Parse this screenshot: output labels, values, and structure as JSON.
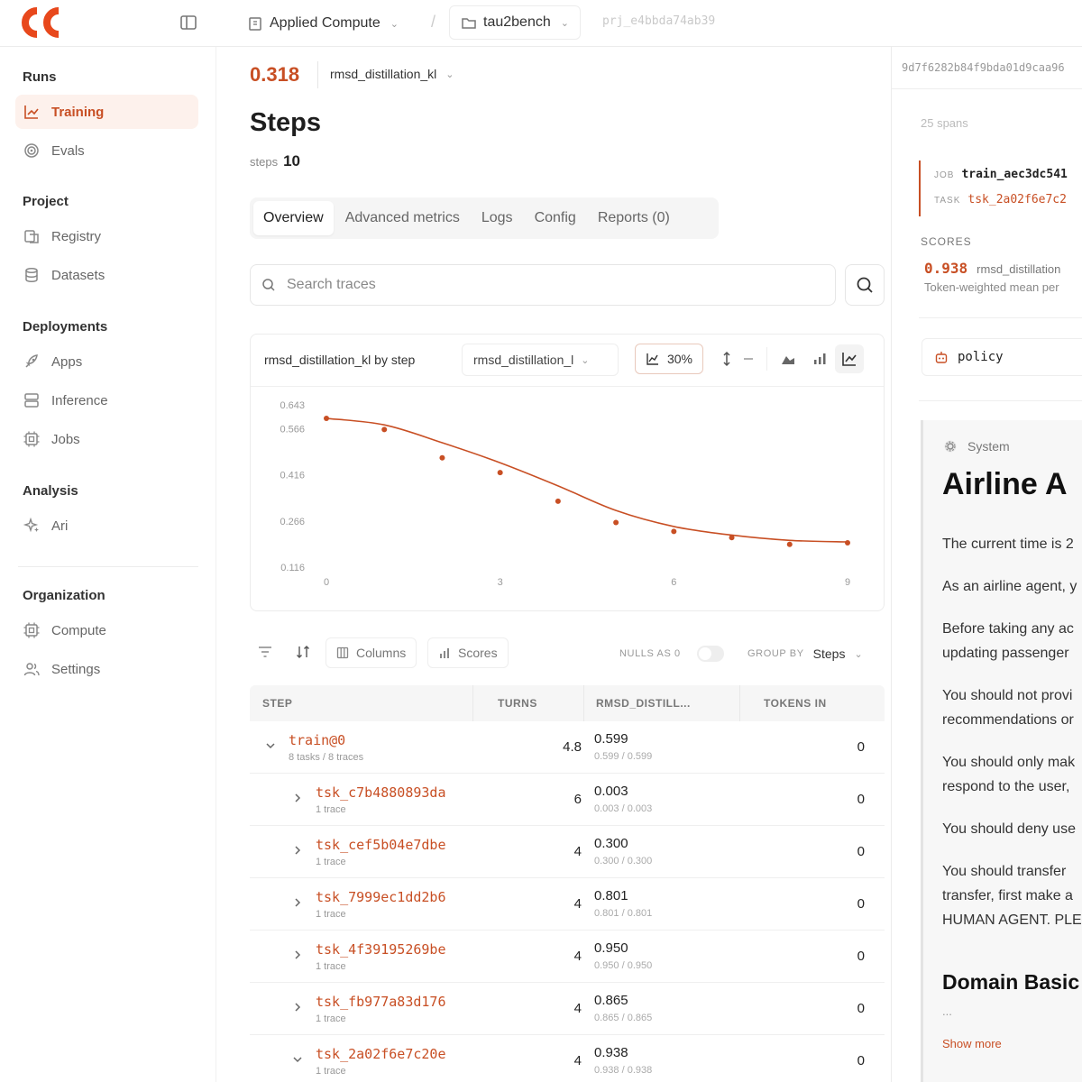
{
  "topbar": {
    "org": "Applied Compute",
    "project": "tau2bench",
    "project_id": "prj_e4bbda74ab39"
  },
  "sidebar": {
    "sections": [
      {
        "title": "Runs",
        "items": [
          {
            "label": "Training",
            "icon": "chart-line-icon",
            "active": true
          },
          {
            "label": "Evals",
            "icon": "target-icon"
          }
        ]
      },
      {
        "title": "Project",
        "items": [
          {
            "label": "Registry",
            "icon": "registry-icon"
          },
          {
            "label": "Datasets",
            "icon": "database-icon"
          }
        ]
      },
      {
        "title": "Deployments",
        "items": [
          {
            "label": "Apps",
            "icon": "rocket-icon"
          },
          {
            "label": "Inference",
            "icon": "server-icon"
          },
          {
            "label": "Jobs",
            "icon": "cpu-icon"
          }
        ]
      },
      {
        "title": "Analysis",
        "items": [
          {
            "label": "Ari",
            "icon": "sparkle-icon"
          }
        ]
      },
      {
        "title": "Organization",
        "items": [
          {
            "label": "Compute",
            "icon": "chip-icon"
          },
          {
            "label": "Settings",
            "icon": "users-icon"
          }
        ]
      }
    ]
  },
  "main": {
    "metric_value": "0.318",
    "metric_name": "rmsd_distillation_kl",
    "title": "Steps",
    "steps_label": "steps",
    "steps_value": "10",
    "tabs": [
      "Overview",
      "Advanced metrics",
      "Logs",
      "Config",
      "Reports (0)"
    ],
    "active_tab": 0,
    "search_placeholder": "Search traces"
  },
  "chart": {
    "title": "rmsd_distillation_kl by step",
    "select_value": "rmsd_distillation_l",
    "smoothing_label": "30%"
  },
  "chart_data": {
    "type": "line",
    "title": "rmsd_distillation_kl by step",
    "x": [
      0,
      1,
      2,
      3,
      4,
      5,
      6,
      7,
      8,
      9
    ],
    "y_points": [
      0.599,
      0.563,
      0.471,
      0.423,
      0.33,
      0.261,
      0.232,
      0.212,
      0.19,
      0.195
    ],
    "y_smoothed": [
      0.599,
      0.578,
      0.52,
      0.455,
      0.38,
      0.3,
      0.248,
      0.22,
      0.203,
      0.198
    ],
    "x_ticks": [
      0,
      3,
      6,
      9
    ],
    "y_ticks": [
      "0.643",
      "0.566",
      "0.416",
      "0.266",
      "0.116"
    ],
    "ylim": [
      0.116,
      0.643
    ],
    "xlim": [
      0,
      9
    ],
    "color": "#c84f24",
    "grid": false
  },
  "toolbar": {
    "columns_label": "Columns",
    "scores_label": "Scores",
    "nulls_label": "NULLS AS 0",
    "group_by_label": "GROUP BY",
    "group_by_value": "Steps"
  },
  "table": {
    "headers": [
      "STEP",
      "TURNS",
      "RMSD_DISTILL...",
      "TOKENS IN"
    ],
    "rows": [
      {
        "name": "train@0",
        "sub": "8 tasks / 8 traces",
        "turns": "4.8",
        "value": "0.599",
        "value_sub": "0.599 / 0.599",
        "tokens": "0",
        "level": 0,
        "expanded": true
      },
      {
        "name": "tsk_c7b4880893da",
        "sub": "1 trace",
        "turns": "6",
        "value": "0.003",
        "value_sub": "0.003 / 0.003",
        "tokens": "0",
        "level": 1,
        "expanded": false
      },
      {
        "name": "tsk_cef5b04e7dbe",
        "sub": "1 trace",
        "turns": "4",
        "value": "0.300",
        "value_sub": "0.300 / 0.300",
        "tokens": "0",
        "level": 1,
        "expanded": false
      },
      {
        "name": "tsk_7999ec1dd2b6",
        "sub": "1 trace",
        "turns": "4",
        "value": "0.801",
        "value_sub": "0.801 / 0.801",
        "tokens": "0",
        "level": 1,
        "expanded": false
      },
      {
        "name": "tsk_4f39195269be",
        "sub": "1 trace",
        "turns": "4",
        "value": "0.950",
        "value_sub": "0.950 / 0.950",
        "tokens": "0",
        "level": 1,
        "expanded": false
      },
      {
        "name": "tsk_fb977a83d176",
        "sub": "1 trace",
        "turns": "4",
        "value": "0.865",
        "value_sub": "0.865 / 0.865",
        "tokens": "0",
        "level": 1,
        "expanded": false
      },
      {
        "name": "tsk_2a02f6e7c20e",
        "sub": "1 trace",
        "turns": "4",
        "value": "0.938",
        "value_sub": "0.938 / 0.938",
        "tokens": "0",
        "level": 1,
        "expanded": true
      }
    ]
  },
  "right_panel": {
    "trace_id": "9d7f6282b84f9bda01d9caa96",
    "spans": "25 spans",
    "job_label": "JOB",
    "job_value": "train_aec3dc541",
    "task_label": "TASK",
    "task_value": "tsk_2a02f6e7c2",
    "scores_heading": "SCORES",
    "score_value": "0.938",
    "score_name": "rmsd_distillation",
    "score_desc": "Token-weighted mean per",
    "policy_label": "policy",
    "system_label": "System",
    "system_title": "Airline A",
    "paragraphs": [
      "The current time is 2",
      "As an airline agent, y",
      "Before taking any ac",
      "updating passenger",
      "You should not provi",
      "recommendations or",
      "You should only mak",
      "respond to the user,",
      "You should deny use",
      "You should transfer",
      "transfer, first make a",
      "HUMAN AGENT. PLE"
    ],
    "domain_heading": "Domain Basic",
    "ellipsis": "...",
    "show_more": "Show more"
  }
}
